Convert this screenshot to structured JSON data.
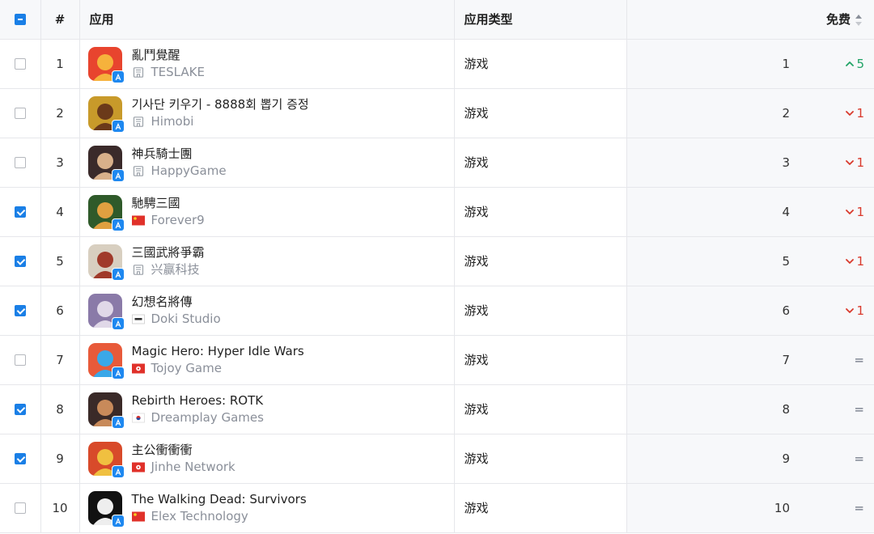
{
  "header": {
    "num": "#",
    "app": "应用",
    "type": "应用类型",
    "rank": "免费"
  },
  "colors": {
    "accent": "#1a7fe6",
    "up": "#21a366",
    "down": "#d9392c",
    "muted": "#8a8f99"
  },
  "rows": [
    {
      "num": "1",
      "checked": false,
      "name": "亂鬥覺醒",
      "publisher": "TESLAKE",
      "pub_icon": "building-icon",
      "type": "游戏",
      "rank": "1",
      "change": "5",
      "trend": "up",
      "icon_colors": [
        "#e8442e",
        "#f6b23c"
      ]
    },
    {
      "num": "2",
      "checked": false,
      "name": "기사단 키우기 - 8888회 뽑기 증정",
      "publisher": "Himobi",
      "pub_icon": "building-icon",
      "type": "游戏",
      "rank": "2",
      "change": "1",
      "trend": "down",
      "icon_colors": [
        "#c89a2a",
        "#6b3a1a"
      ]
    },
    {
      "num": "3",
      "checked": false,
      "name": "神兵騎士團",
      "publisher": "HappyGame",
      "pub_icon": "building-icon",
      "type": "游戏",
      "rank": "3",
      "change": "1",
      "trend": "down",
      "icon_colors": [
        "#3a2a2a",
        "#d8b08a"
      ]
    },
    {
      "num": "4",
      "checked": true,
      "name": "馳騁三國",
      "publisher": "Forever9",
      "pub_icon": "flag-cn-icon",
      "type": "游戏",
      "rank": "4",
      "change": "1",
      "trend": "down",
      "icon_colors": [
        "#2f5a2a",
        "#e0a040"
      ]
    },
    {
      "num": "5",
      "checked": true,
      "name": "三國武將爭霸",
      "publisher": "兴赢科技",
      "pub_icon": "building-icon",
      "type": "游戏",
      "rank": "5",
      "change": "1",
      "trend": "down",
      "icon_colors": [
        "#d8cfc0",
        "#a03a2a"
      ]
    },
    {
      "num": "6",
      "checked": true,
      "name": "幻想名將傳",
      "publisher": "Doki Studio",
      "pub_icon": "flag-tw-icon",
      "type": "游戏",
      "rank": "6",
      "change": "1",
      "trend": "down",
      "icon_colors": [
        "#8a7aa8",
        "#e0d8e8"
      ]
    },
    {
      "num": "7",
      "checked": false,
      "name": "Magic Hero: Hyper Idle Wars",
      "publisher": "Tojoy Game",
      "pub_icon": "flag-hk-icon",
      "type": "游戏",
      "rank": "7",
      "change": "=",
      "trend": "same",
      "icon_colors": [
        "#e85a3a",
        "#3aa8e8"
      ]
    },
    {
      "num": "8",
      "checked": true,
      "name": "Rebirth Heroes: ROTK",
      "publisher": "Dreamplay Games",
      "pub_icon": "flag-kr-icon",
      "type": "游戏",
      "rank": "8",
      "change": "=",
      "trend": "same",
      "icon_colors": [
        "#3a2a28",
        "#c88a5a"
      ]
    },
    {
      "num": "9",
      "checked": true,
      "name": "主公衝衝衝",
      "publisher": "Jinhe Network",
      "pub_icon": "flag-hk-icon",
      "type": "游戏",
      "rank": "9",
      "change": "=",
      "trend": "same",
      "icon_colors": [
        "#d84a2a",
        "#f0c040"
      ]
    },
    {
      "num": "10",
      "checked": false,
      "name": "The Walking Dead: Survivors",
      "publisher": "Elex Technology",
      "pub_icon": "flag-cn-icon",
      "type": "游戏",
      "rank": "10",
      "change": "=",
      "trend": "same",
      "icon_colors": [
        "#111111",
        "#eeeeee"
      ]
    }
  ]
}
